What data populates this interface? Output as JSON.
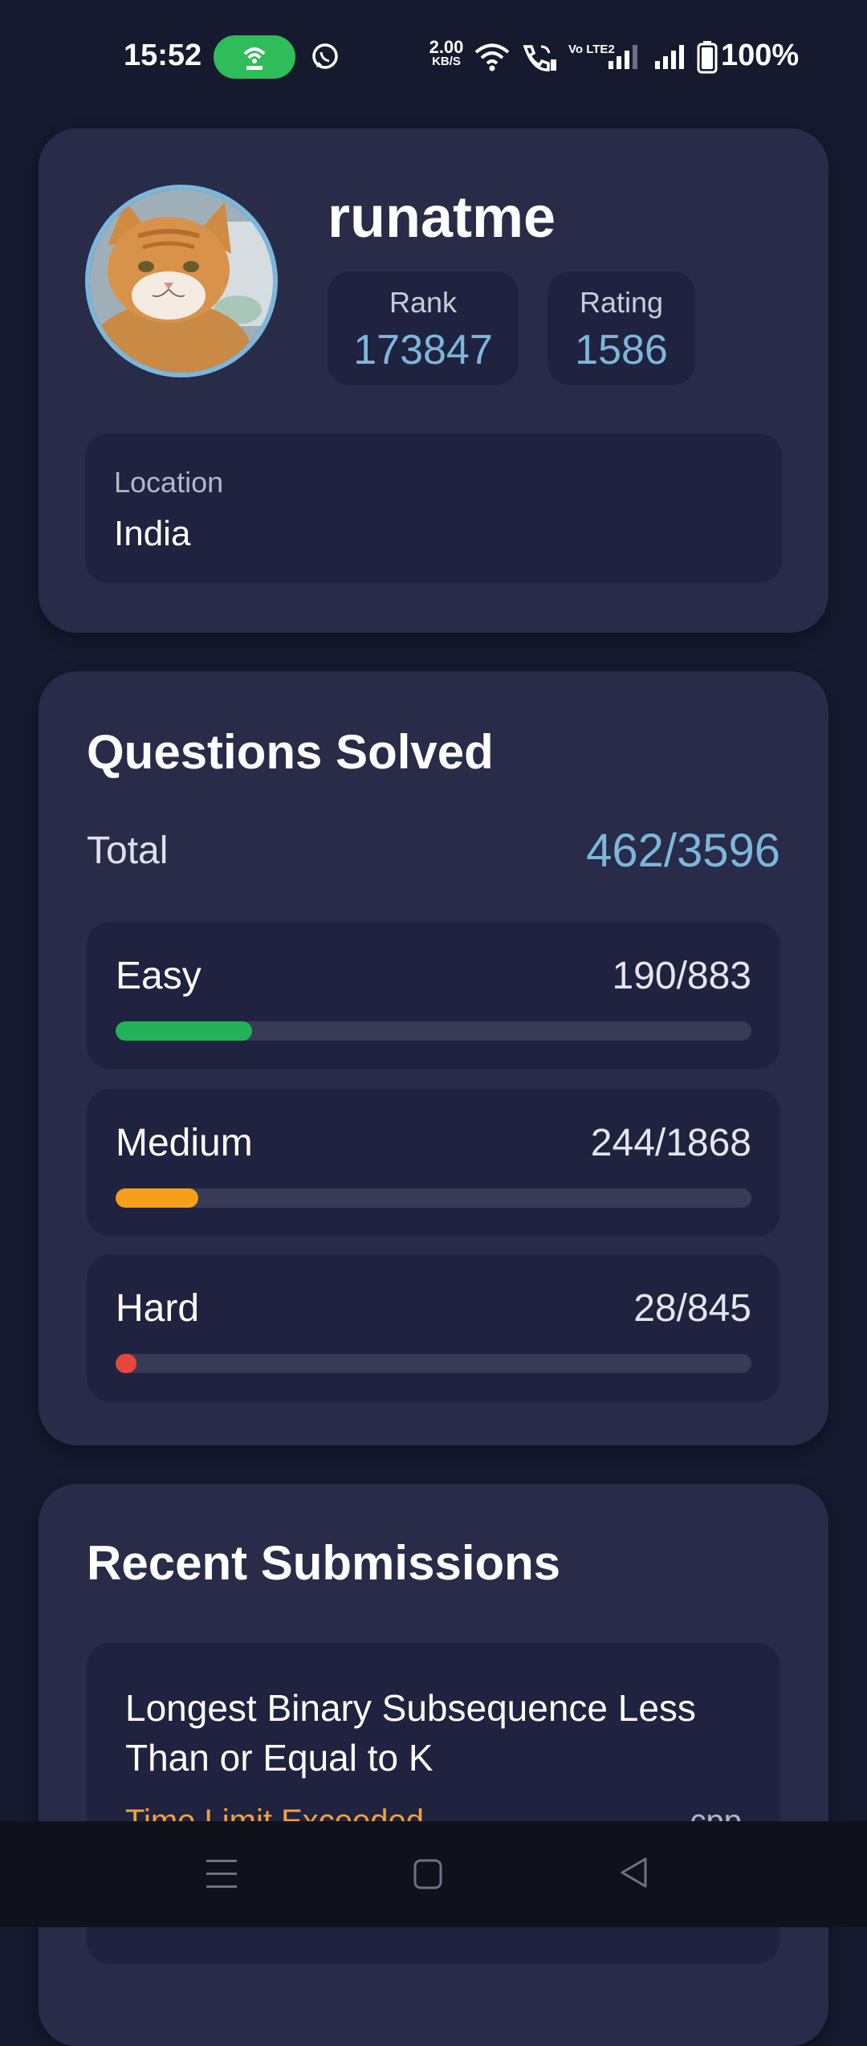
{
  "status_bar": {
    "time": "15:52",
    "speed_value": "2.00",
    "speed_unit": "KB/S",
    "volte": "Vo LTE2",
    "battery": "100%",
    "icons": [
      "hotspot-icon",
      "whatsapp-icon",
      "wifi-icon",
      "wifi-call-icon",
      "signal-icon",
      "signal-icon",
      "battery-icon"
    ]
  },
  "profile": {
    "username": "runatme",
    "rank_label": "Rank",
    "rank_value": "173847",
    "rating_label": "Rating",
    "rating_value": "1586",
    "location_label": "Location",
    "location_value": "India"
  },
  "questions_solved": {
    "title": "Questions Solved",
    "total_label": "Total",
    "total_value": "462/3596",
    "difficulties": [
      {
        "name": "Easy",
        "count": "190/883",
        "solved": 190,
        "total": 883,
        "color": "#22b35a"
      },
      {
        "name": "Medium",
        "count": "244/1868",
        "solved": 244,
        "total": 1868,
        "color": "#f5a01a"
      },
      {
        "name": "Hard",
        "count": "28/845",
        "solved": 28,
        "total": 845,
        "color": "#e5473a"
      }
    ]
  },
  "recent_submissions": {
    "title": "Recent Submissions",
    "items": [
      {
        "title": "Longest Binary Subsequence Less Than or Equal to K",
        "status": "Time Limit Exceeded",
        "lang": "cpp"
      }
    ]
  },
  "nav_bar": {
    "icons": [
      "menu-icon",
      "home-icon",
      "back-icon"
    ]
  },
  "colors": {
    "background": "#161a2e",
    "card": "#282c48",
    "inner_box": "#1f2340",
    "accent": "#7db6db"
  }
}
